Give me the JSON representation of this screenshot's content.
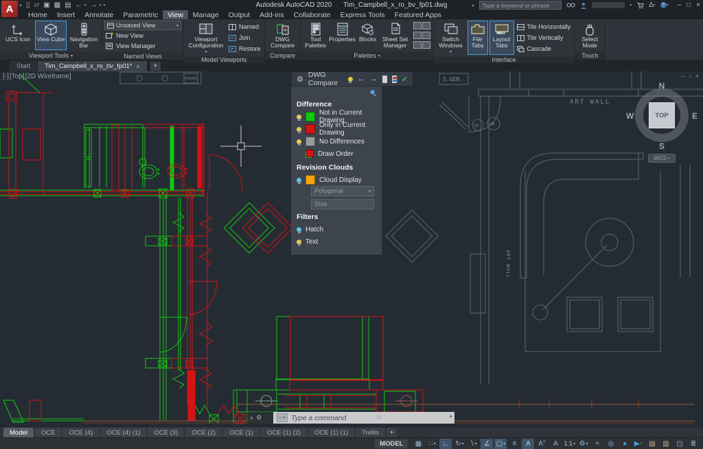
{
  "colors": {
    "compare_green": "#12c812",
    "compare_red": "#d41414",
    "no_diff_gray": "#9a9a9a",
    "cloud_orange": "#f2a60d",
    "accent_blue": "#4f9bd8",
    "check_green": "#3ac24e",
    "bulb_yellow": "#ecc84f",
    "bulb_blue": "#56c3e8",
    "canvas_bg": "#252b33",
    "gray_line": "#5c6771"
  },
  "title_bar": {
    "logo_letter": "A",
    "app_title": "Autodesk AutoCAD 2020",
    "document_title": "Tim_Campbell_x_ro_bv_fp01.dwg",
    "search_placeholder": "Type a keyword or phrase",
    "window_controls": {
      "minimize": "–",
      "maximize": "□",
      "close": "×"
    }
  },
  "quick_access": {
    "items": [
      {
        "name": "qnew",
        "glyph": "▯"
      },
      {
        "name": "open",
        "glyph": "▱"
      },
      {
        "name": "save",
        "glyph": "▣"
      },
      {
        "name": "save-as",
        "glyph": "▩"
      },
      {
        "name": "plot",
        "glyph": "▤"
      },
      {
        "name": "undo",
        "glyph": "←",
        "caret": "▾"
      },
      {
        "name": "redo",
        "glyph": "→",
        "caret": "▾"
      },
      {
        "name": "qat-menu",
        "glyph": "▾"
      }
    ]
  },
  "menu": {
    "items": [
      "Home",
      "Insert",
      "Annotate",
      "Parametric",
      "View",
      "Manage",
      "Output",
      "Add-ins",
      "Collaborate",
      "Express Tools",
      "Featured Apps"
    ],
    "active": "View"
  },
  "ribbon": {
    "groups": [
      {
        "label": "Viewport Tools",
        "caret": "▾",
        "buttons": [
          {
            "label": "UCS Icon"
          },
          {
            "label": "View Cube"
          },
          {
            "label": "Navigation Bar"
          }
        ]
      },
      {
        "label": "Named Views",
        "dropdown_value": "Unsaved View",
        "items": [
          {
            "label": "New View"
          },
          {
            "label": "View Manager"
          }
        ]
      },
      {
        "label": "Model Viewports",
        "big": {
          "label": "Viewport Configuration"
        },
        "items": [
          {
            "label": "Named"
          },
          {
            "label": "Join"
          },
          {
            "label": "Restore"
          }
        ]
      },
      {
        "label": "Compare",
        "big": {
          "label": "DWG Compare"
        }
      },
      {
        "label": "Palettes",
        "caret": "▾",
        "buttons": [
          {
            "label": "Tool Palettes"
          },
          {
            "label": "Properties"
          },
          {
            "label": "Blocks"
          },
          {
            "label": "Sheet Set Manager"
          }
        ]
      },
      {
        "label": "Interface",
        "buttons": [
          {
            "label": "Switch Windows"
          },
          {
            "label": "File Tabs"
          },
          {
            "label": "Layout Tabs"
          }
        ],
        "items": [
          {
            "label": "Tile Horizontally"
          },
          {
            "label": "Tile Vertically"
          },
          {
            "label": "Cascade"
          }
        ]
      },
      {
        "label": "Touch",
        "big": {
          "label": "Select Mode"
        }
      }
    ]
  },
  "file_tabs": {
    "tabs": [
      {
        "label": "Start"
      },
      {
        "label": "Tim_Campbell_x_ro_bv_fp01*"
      }
    ],
    "close_glyph": "×",
    "add_glyph": "+"
  },
  "compare_toolbar": {
    "gear_glyph": "⚙",
    "title": "DWG Compare",
    "prev_glyph": "←",
    "next_glyph": "→",
    "done_glyph": "✓"
  },
  "compare_panel": {
    "difference": {
      "title": "Difference",
      "rows": [
        {
          "label": "Not in Current Drawing"
        },
        {
          "label": "Only in Current Drawing"
        },
        {
          "label": "No Differences"
        },
        {
          "label": "Draw Order"
        }
      ]
    },
    "revision_clouds": {
      "title": "Revision Clouds",
      "row_label": "Cloud Display",
      "dropdown_value": "Polygonal",
      "dropdown_caret": "▾",
      "size_placeholder": "Size"
    },
    "filters": {
      "title": "Filters",
      "rows": [
        {
          "label": "Hatch"
        },
        {
          "label": "Text"
        }
      ]
    }
  },
  "drawing": {
    "viewport_controls": {
      "minimized": "[-]",
      "view": "[Top]",
      "visual_style": "[2D Wireframe]"
    },
    "inner_window": {
      "minimize": "–",
      "restore": "▫",
      "close": "×"
    },
    "labels": {
      "art_wall_top": "ART WALL",
      "art_wall_side": "ART WALL",
      "sgen": "S.GEN.",
      "sd": "SD",
      "cm": "CM"
    },
    "viewcube": {
      "north": "N",
      "south": "S",
      "east": "E",
      "west": "W",
      "face": "TOP",
      "wcs": "WCS",
      "wcs_caret": "▾"
    }
  },
  "command_line": {
    "close_glyph": "×",
    "tools_glyph": "⚙",
    "chip_caret": "▾",
    "placeholder": "Type a command",
    "ghost_glyph": "⊠",
    "scroll_up_glyph": "▲"
  },
  "layout_tabs": {
    "tabs": [
      "Model",
      "OCE",
      "OCE (4)",
      "OCE (4) (1)",
      "OCE (3)",
      "OCE (2)",
      "OCE (1)",
      "OCE (1) (2)",
      "OCE (1) (1)",
      "Trellis"
    ],
    "active": "Model",
    "add_glyph": "+"
  },
  "status_bar": {
    "model_label": "MODEL",
    "items": [
      {
        "name": "grid-display",
        "glyph": "▦"
      },
      {
        "name": "snap-mode",
        "glyph": "∷",
        "caret": "▾"
      },
      {
        "name": "dynamic-input",
        "glyph": "∟"
      },
      {
        "name": "polar-tracking",
        "glyph": "↻",
        "caret": "▾"
      },
      {
        "name": "isometric-drafting",
        "glyph": "∖",
        "caret": "▾"
      },
      {
        "name": "object-snap-tracking",
        "glyph": "∠"
      },
      {
        "name": "object-snap",
        "glyph": "▢",
        "caret": "▾"
      },
      {
        "name": "lineweight",
        "glyph": "≡"
      },
      {
        "name": "annotation-visibility",
        "glyph": "A"
      },
      {
        "name": "autoscale",
        "glyph": "A°"
      },
      {
        "name": "annotation-scale-icon",
        "glyph": "A"
      },
      {
        "name": "annotation-scale",
        "glyph": "1:1",
        "caret": "▾"
      },
      {
        "name": "workspace-switching",
        "glyph": "⚙",
        "caret": "▾"
      },
      {
        "name": "isolate-objects-plus",
        "glyph": "+"
      },
      {
        "name": "isolate-objects",
        "glyph": "◎"
      },
      {
        "name": "hardware-acceleration",
        "glyph": "●"
      },
      {
        "name": "graphics-performance",
        "glyph": "▶",
        "check": "✓"
      },
      {
        "name": "trusted-locations",
        "glyph": "▤"
      },
      {
        "name": "units",
        "glyph": "▥"
      },
      {
        "name": "clean-screen",
        "glyph": "◳"
      },
      {
        "name": "customization",
        "glyph": "≣"
      }
    ]
  }
}
